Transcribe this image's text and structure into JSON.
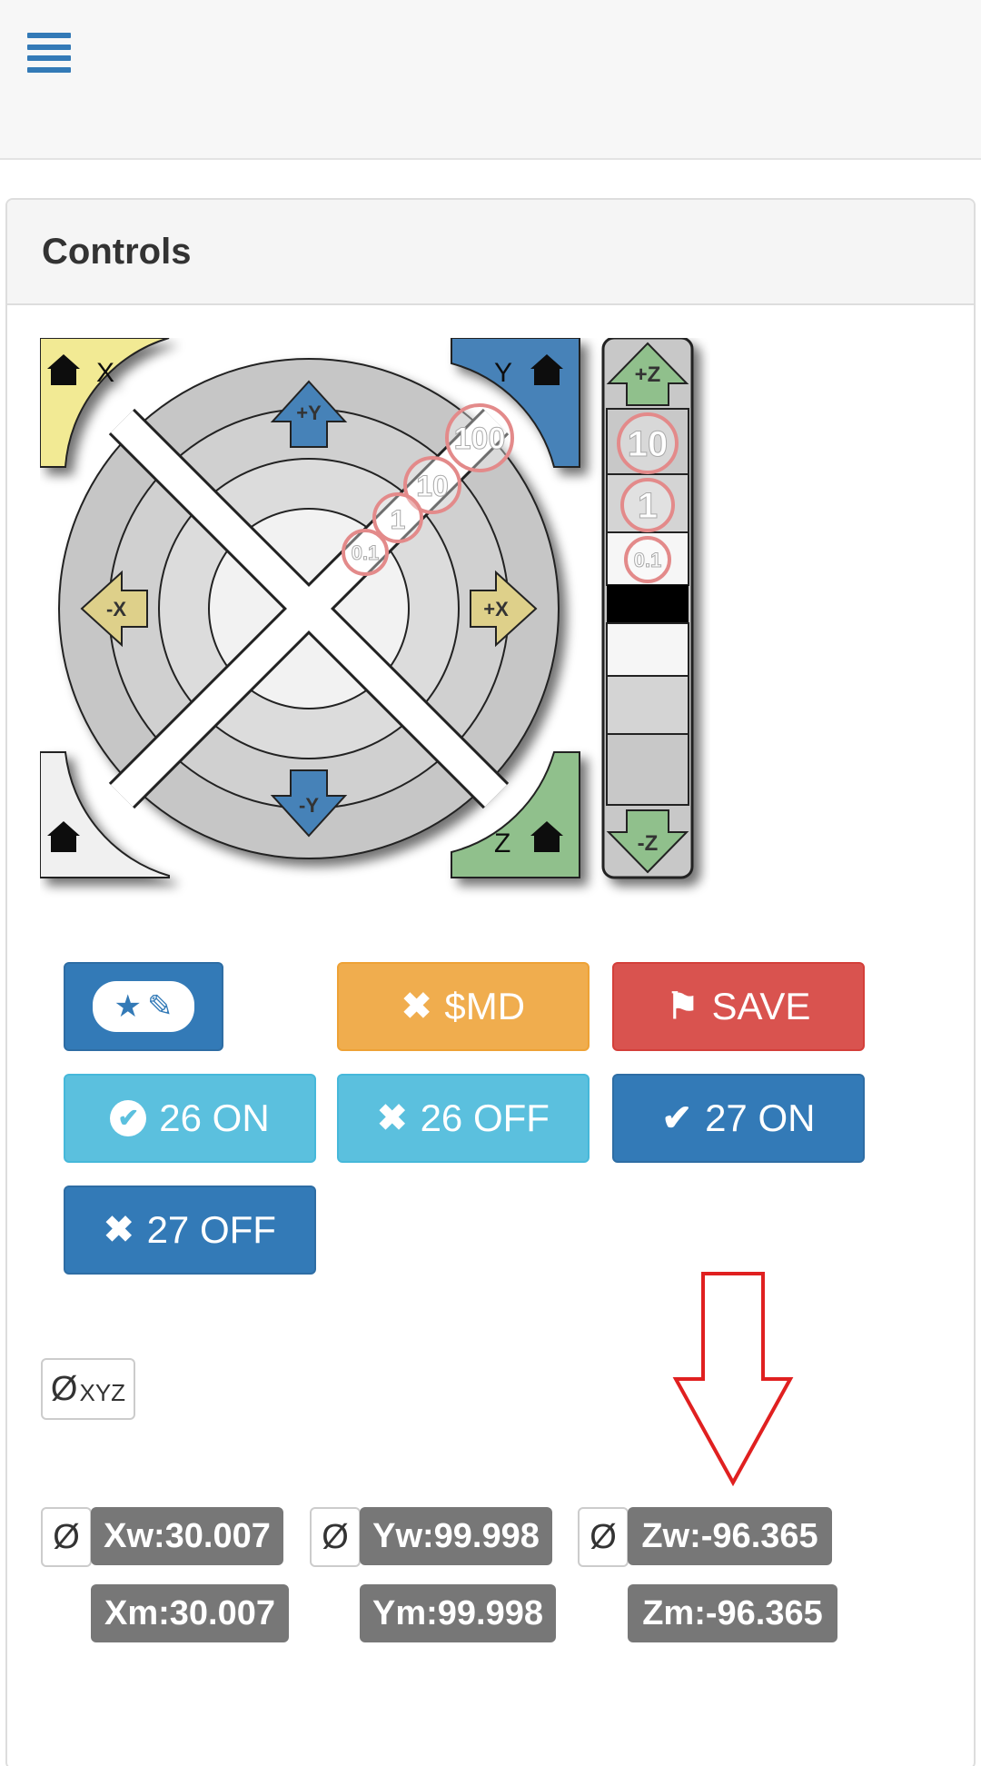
{
  "header": {
    "menu_icon": "hamburger-menu-icon"
  },
  "panel": {
    "title": "Controls"
  },
  "jog": {
    "home_x_label": "X",
    "home_y_label": "Y",
    "home_z_label": "Z",
    "plus_y": "+Y",
    "minus_y": "-Y",
    "plus_x": "+X",
    "minus_x": "-X",
    "plus_z": "+Z",
    "minus_z": "-Z",
    "steps": [
      "100",
      "10",
      "1",
      "0.1"
    ],
    "z_steps": [
      "10",
      "1",
      "0.1"
    ],
    "colors": {
      "home_x": "#f2ea94",
      "home_y": "#4682b8",
      "home_z": "#90c08c",
      "home_all": "#f0f0f0"
    }
  },
  "buttons": {
    "macro_icons": "star-pencil-icon",
    "md_label": "$MD",
    "save_label": "SAVE",
    "b26_on": "26 ON",
    "b26_off": "26 OFF",
    "b27_on": "27 ON",
    "b27_off": "27 OFF"
  },
  "zero": {
    "all_symbol": "Ø",
    "all_sub": "XYZ",
    "x_symbol": "Ø",
    "y_symbol": "Ø",
    "z_symbol": "Ø"
  },
  "positions": {
    "xw": "Xw:30.007",
    "yw": "Yw:99.998",
    "zw": "Zw:-96.365",
    "xm": "Xm:30.007",
    "ym": "Ym:99.998",
    "zm": "Zm:-96.365"
  }
}
